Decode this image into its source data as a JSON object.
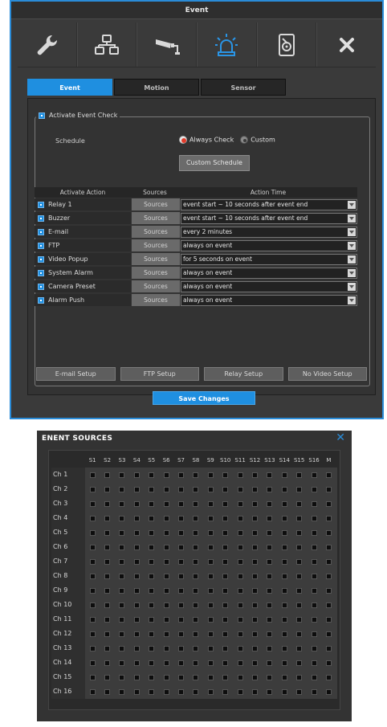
{
  "event_window": {
    "title": "Event",
    "toolbar": [
      {
        "name": "wrench-icon"
      },
      {
        "name": "network-icon"
      },
      {
        "name": "camera-icon"
      },
      {
        "name": "alarm-light-icon",
        "active": true
      },
      {
        "name": "storage-icon"
      },
      {
        "name": "close-icon"
      }
    ],
    "tabs": [
      {
        "label": "Event",
        "active": true
      },
      {
        "label": "Motion",
        "active": false
      },
      {
        "label": "Sensor",
        "active": false
      }
    ],
    "activate_label": "Activate Event Check",
    "schedule_label": "Schedule",
    "schedule_options": {
      "always": "Always Check",
      "custom": "Custom",
      "selected": "always"
    },
    "custom_schedule_button": "Custom Schedule",
    "table_headers": {
      "action": "Activate Action",
      "sources": "Sources",
      "time": "Action Time"
    },
    "actions": [
      {
        "label": "Relay 1",
        "sources": "Sources",
        "time": "event start ~ 10 seconds after event end"
      },
      {
        "label": "Buzzer",
        "sources": "Sources",
        "time": "event start ~ 10 seconds after event end"
      },
      {
        "label": "E-mail",
        "sources": "Sources",
        "time": "every 2 minutes"
      },
      {
        "label": "FTP",
        "sources": "Sources",
        "time": "always on event"
      },
      {
        "label": "Video Popup",
        "sources": "Sources",
        "time": "for 5 seconds on event"
      },
      {
        "label": "System Alarm",
        "sources": "Sources",
        "time": "always on event"
      },
      {
        "label": "Camera Preset",
        "sources": "Sources",
        "time": "always on event"
      },
      {
        "label": "Alarm Push",
        "sources": "Sources",
        "time": "always on event"
      }
    ],
    "setup_buttons": [
      "E-mail Setup",
      "FTP Setup",
      "Relay Setup",
      "No Video Setup"
    ],
    "save_button": "Save Changes"
  },
  "sources_window": {
    "title": "ENENT SOURCES",
    "close": "✕",
    "columns": [
      "S1",
      "S2",
      "S3",
      "S4",
      "S5",
      "S6",
      "S7",
      "S8",
      "S9",
      "S10",
      "S11",
      "S12",
      "S13",
      "S14",
      "S15",
      "S16",
      "M"
    ],
    "rows": [
      "Ch 1",
      "Ch 2",
      "Ch 3",
      "Ch 4",
      "Ch 5",
      "Ch 6",
      "Ch 7",
      "Ch 8",
      "Ch 9",
      "Ch 10",
      "Ch 11",
      "Ch 12",
      "Ch 13",
      "Ch 14",
      "Ch 15",
      "Ch 16"
    ]
  },
  "colors": {
    "accent": "#1f8fe0",
    "alert": "#e23b2a",
    "panel": "#3a3a3a"
  }
}
